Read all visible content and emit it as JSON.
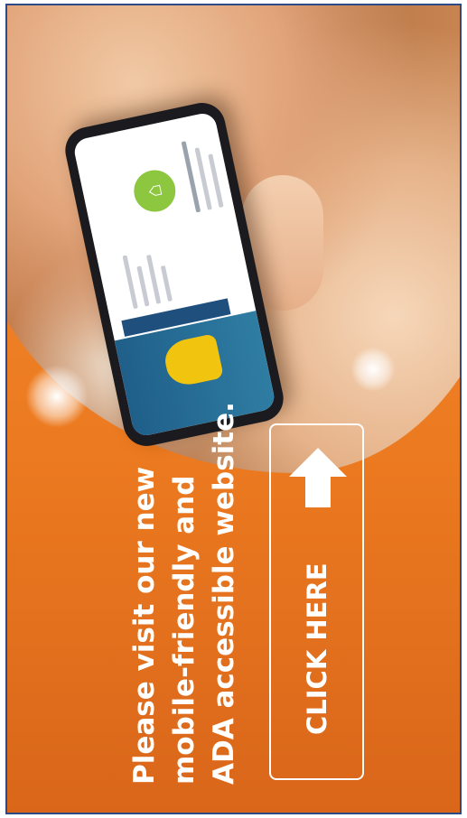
{
  "ad": {
    "message_lines": [
      "Please visit our new",
      "mobile-friendly and",
      "ADA accessible website."
    ],
    "cta_label": "CLICK HERE"
  },
  "colors": {
    "background_orange": "#ec7a20",
    "frame_border": "#2c4a86",
    "text": "#ffffff",
    "phone_logo_green": "#8dc63f"
  },
  "icons": {
    "cta_arrow": "arrow-right-icon"
  }
}
